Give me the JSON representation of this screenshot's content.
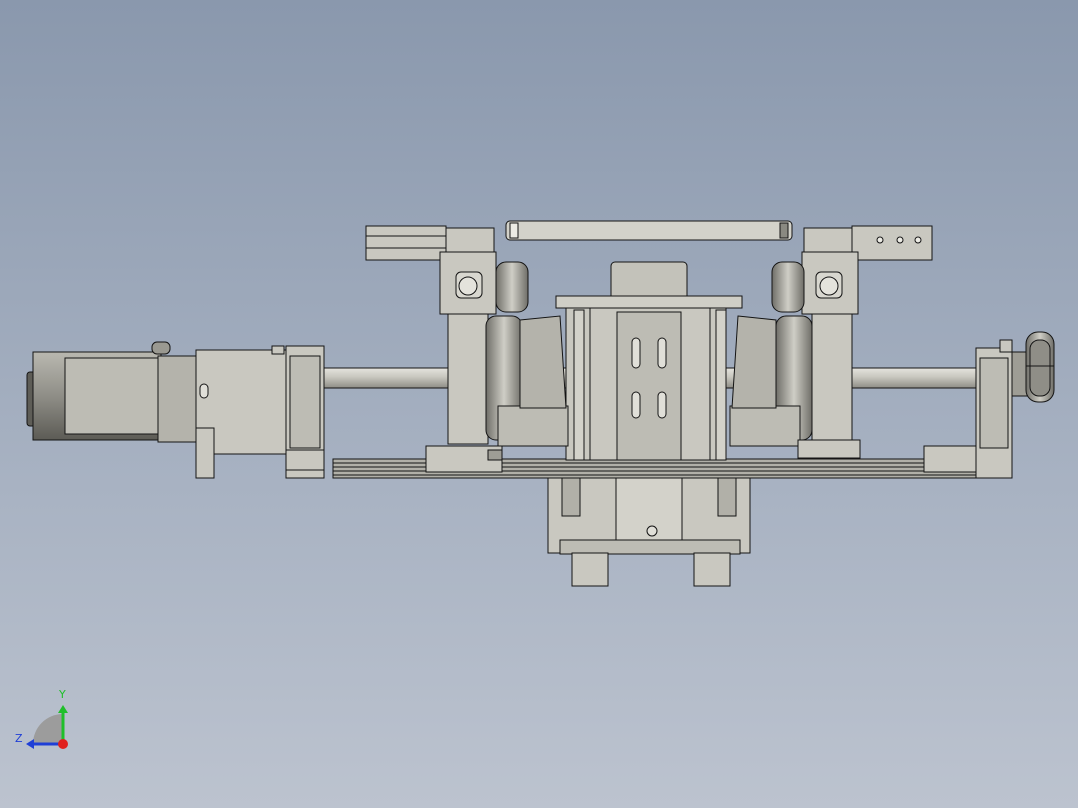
{
  "triad": {
    "y_label": "Y",
    "z_label": "Z",
    "colors": {
      "y_axis": "#1fbf2a",
      "z_axis": "#1f3fd6",
      "x_axis": "#e0201e"
    }
  },
  "part_colors": {
    "body": "#c9c8c0",
    "shade": "#a9a89f",
    "dark": "#74736c",
    "line": "#141414"
  }
}
